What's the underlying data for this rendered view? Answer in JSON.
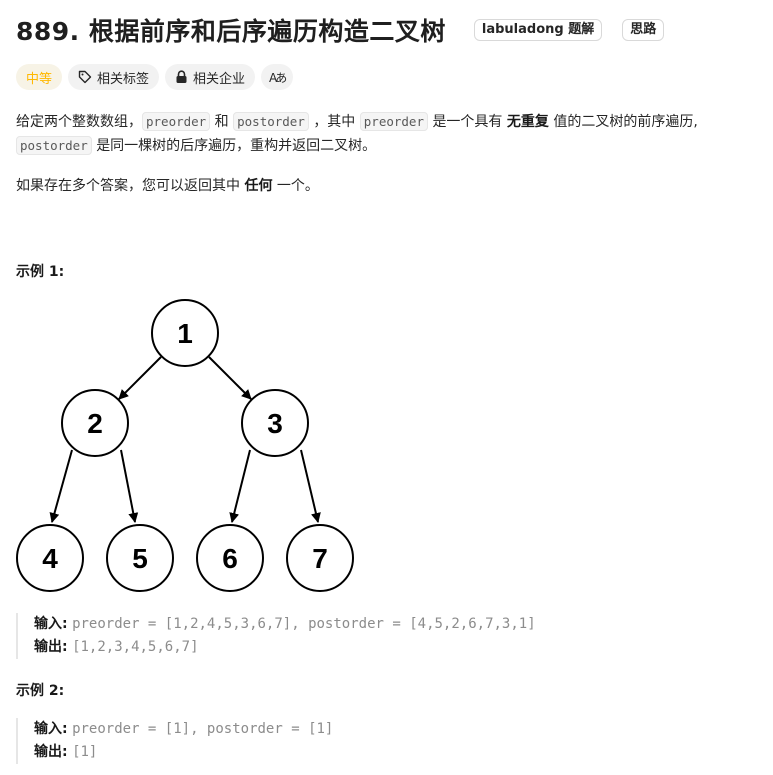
{
  "problem": {
    "title": "889. 根据前序和后序遍历构造二叉树",
    "solution_btn": "labuladong 题解",
    "idea_btn": "思路"
  },
  "tags": {
    "difficulty": "中等",
    "related_tags": "相关标签",
    "related_companies": "相关企业",
    "font_toggle": "Aあ"
  },
  "description": {
    "line1": {
      "t1": "给定两个整数数组，",
      "code1": "preorder",
      "t2": "和",
      "code2": "postorder",
      "t3": "，其中",
      "code3": "preorder",
      "t4": "是一个具有",
      "bold": "无重复",
      "t5": "值的二叉树的前序遍历,"
    },
    "line2": {
      "code": "postorder",
      "text": "是同一棵树的后序遍历，重构并返回二叉树。"
    },
    "line3": {
      "t1": "如果存在多个答案，您可以返回其中",
      "bold": "任何",
      "t2": "一个。"
    }
  },
  "examples": [
    {
      "title": "示例 1:",
      "input_label": "输入:",
      "input": "preorder = [1,2,4,5,3,6,7], postorder = [4,5,2,6,7,3,1]",
      "output_label": "输出:",
      "output": "[1,2,3,4,5,6,7]",
      "tree_nodes": [
        "1",
        "2",
        "3",
        "4",
        "5",
        "6",
        "7"
      ]
    },
    {
      "title": "示例 2:",
      "input_label": "输入:",
      "input": "preorder = [1], postorder = [1]",
      "output_label": "输出:",
      "output": "[1]"
    }
  ],
  "colors": {
    "difficulty": "#ffb800",
    "text": "#262626",
    "code_bg": "#f5f5f5"
  }
}
